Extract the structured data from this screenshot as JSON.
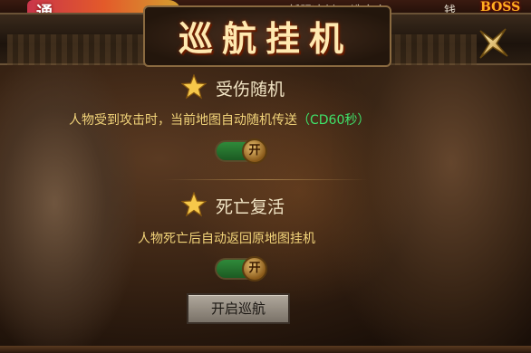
{
  "hud": {
    "event_banner": "通",
    "marquee_text": "新服冲刺 天选之人",
    "money_label": "钱",
    "boss_label": "BOSS"
  },
  "dialog": {
    "title": "巡航挂机",
    "close_icon": "close-x-icon"
  },
  "options": [
    {
      "title": "受伤随机",
      "description": "人物受到攻击时，当前地图自动随机传送",
      "note": "（CD60秒）",
      "toggle_label": "开",
      "enabled": true
    },
    {
      "title": "死亡复活",
      "description": "人物死亡后自动返回原地图挂机",
      "toggle_label": "开",
      "enabled": true
    }
  ],
  "actions": {
    "start_label": "开启巡航"
  },
  "colors": {
    "desc": "#f2d47a",
    "note": "#3fe26a",
    "title": "#f1e4c4",
    "toggle_on": "#2f8a3a"
  }
}
